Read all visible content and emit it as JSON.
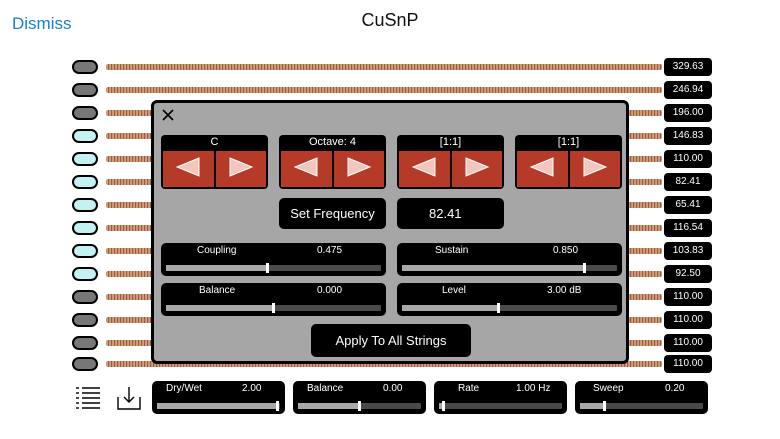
{
  "header": {
    "dismiss_label": "Dismiss",
    "title": "CuSnP"
  },
  "strings": [
    {
      "frequency": "329.63",
      "peg_lit": false
    },
    {
      "frequency": "246.94",
      "peg_lit": false
    },
    {
      "frequency": "196.00",
      "peg_lit": false
    },
    {
      "frequency": "146.83",
      "peg_lit": true
    },
    {
      "frequency": "110.00",
      "peg_lit": true
    },
    {
      "frequency": "82.41",
      "peg_lit": true
    },
    {
      "frequency": "65.41",
      "peg_lit": true
    },
    {
      "frequency": "116.54",
      "peg_lit": true
    },
    {
      "frequency": "103.83",
      "peg_lit": true
    },
    {
      "frequency": "92.50",
      "peg_lit": true
    },
    {
      "frequency": "110.00",
      "peg_lit": false
    },
    {
      "frequency": "110.00",
      "peg_lit": false
    },
    {
      "frequency": "110.00",
      "peg_lit": false
    },
    {
      "frequency": "110.00",
      "peg_lit": false
    }
  ],
  "dialog": {
    "spinners": [
      {
        "label": "C"
      },
      {
        "label": "Octave: 4"
      },
      {
        "label": "[1:1]"
      },
      {
        "label": "[1:1]"
      }
    ],
    "set_frequency_label": "Set Frequency",
    "frequency_value": "82.41",
    "sliders": [
      {
        "label": "Coupling",
        "value": "0.475",
        "fraction": 0.475
      },
      {
        "label": "Sustain",
        "value": "0.850",
        "fraction": 0.85
      },
      {
        "label": "Balance",
        "value": "0.000",
        "fraction": 0.5
      },
      {
        "label": "Level",
        "value": "3.00 dB",
        "fraction": 0.45
      }
    ],
    "apply_label": "Apply To All Strings"
  },
  "effects": [
    {
      "label": "Dry/Wet",
      "value": "2.00",
      "fraction": 0.98
    },
    {
      "label": "Balance",
      "value": "0.00",
      "fraction": 0.5
    },
    {
      "label": "Rate",
      "value": "1.00 Hz",
      "fraction": 0.04
    },
    {
      "label": "Sweep",
      "value": "0.20",
      "fraction": 0.2
    }
  ],
  "colors": {
    "accent": "#1a7fd4",
    "button_red": "#b63a28",
    "peg_lit": "#c4f1f1",
    "panel": "#a6a6a6"
  },
  "icons": {
    "list": "list-icon",
    "download": "download-tray-icon",
    "close": "close-icon"
  }
}
